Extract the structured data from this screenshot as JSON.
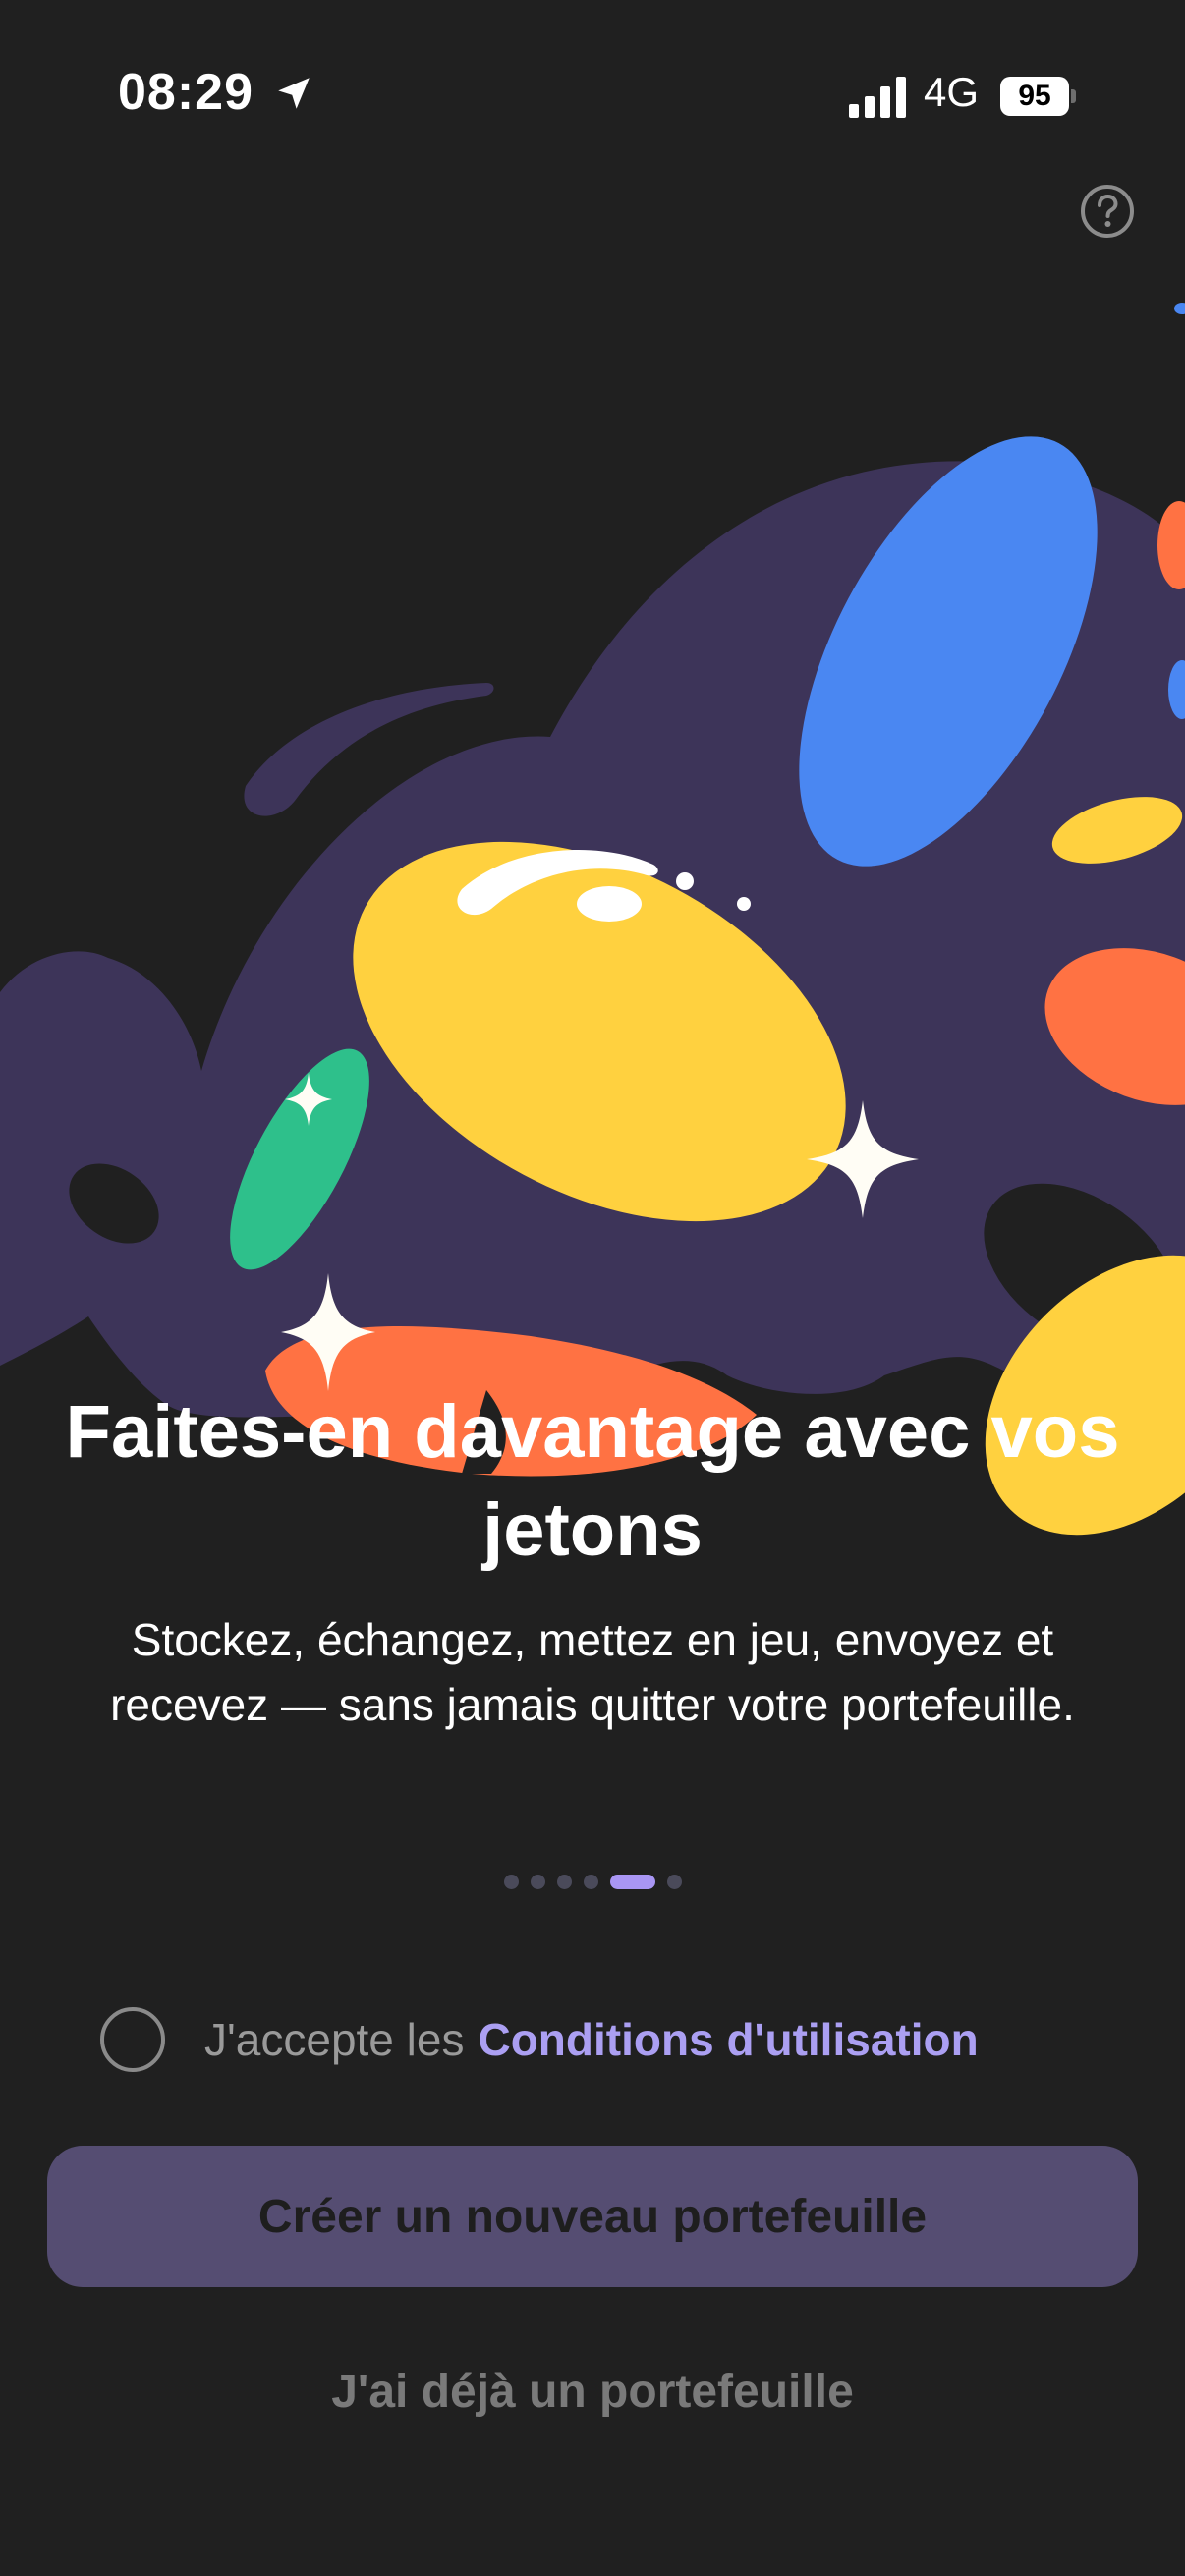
{
  "status_bar": {
    "time": "08:29",
    "network": "4G",
    "battery": "95"
  },
  "onboarding": {
    "title": "Faites-en davantage avec vos jetons",
    "subtitle": "Stockez, échangez, mettez en jeu, envoyez et recevez — sans jamais quitter votre portefeuille.",
    "page_indicator": {
      "total": 6,
      "active_index": 4
    }
  },
  "terms": {
    "prefix": "J'accepte les",
    "link": "Conditions d'utilisation",
    "checked": false
  },
  "buttons": {
    "create_wallet": "Créer un nouveau portefeuille",
    "existing_wallet": "J'ai déjà un portefeuille"
  },
  "colors": {
    "background": "#202020",
    "accent": "#ab9ff2",
    "blob_purple": "#3d3459",
    "blue": "#4a87f2",
    "yellow": "#ffd13f",
    "orange": "#ff7243",
    "green": "#2ec08b",
    "button_bg": "#554d72"
  },
  "icons": {
    "help": "question-circle-icon",
    "location": "location-arrow-icon",
    "signal": "cellular-signal-icon",
    "battery": "battery-icon"
  }
}
